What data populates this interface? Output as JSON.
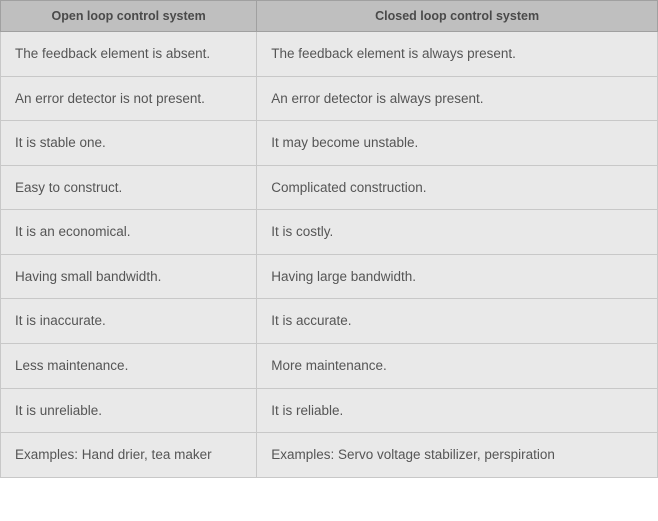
{
  "chart_data": {
    "type": "table",
    "title": "",
    "columns": [
      "Open loop control system",
      "Closed loop control system"
    ],
    "rows": [
      [
        "The feedback element is absent.",
        "The feedback element is always present."
      ],
      [
        "An error detector is not present.",
        "An error detector is always present."
      ],
      [
        "It is stable one.",
        "It may become unstable."
      ],
      [
        "Easy to construct.",
        "Complicated construction."
      ],
      [
        "It is an economical.",
        "It is costly."
      ],
      [
        "Having small bandwidth.",
        "Having large bandwidth."
      ],
      [
        "It is inaccurate.",
        "It is accurate."
      ],
      [
        "Less maintenance.",
        "More maintenance."
      ],
      [
        "It is unreliable.",
        "It is reliable."
      ],
      [
        "Examples: Hand drier, tea maker",
        "Examples: Servo voltage stabilizer, perspiration"
      ]
    ]
  }
}
